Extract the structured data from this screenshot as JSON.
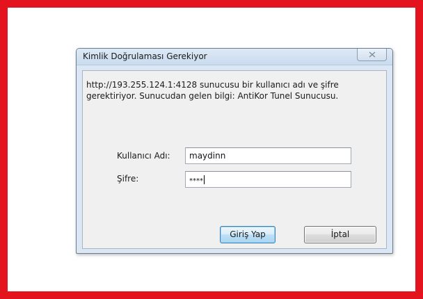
{
  "dialog": {
    "title": "Kimlik Doğrulaması Gerekiyor",
    "close_icon": "close-x-icon",
    "message": "http://193.255.124.1:4128 sunucusu bir kullanıcı adı ve şifre gerektiriyor. Sunucudan gelen bilgi: AntiKor Tunel Sunucusu.",
    "username_label": "Kullanıcı Adı:",
    "username_value": "maydinn",
    "password_label": "Şifre:",
    "password_value": "****",
    "login_button": "Giriş Yap",
    "cancel_button": "İptal"
  },
  "colors": {
    "frame_border": "#e3141e",
    "dialog_bg": "#dbe7f4",
    "client_bg": "#f0f0f0"
  }
}
